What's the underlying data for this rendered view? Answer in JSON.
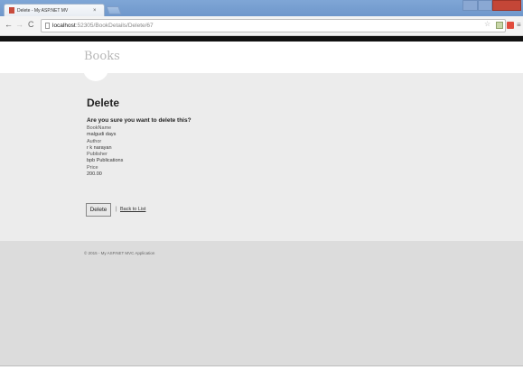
{
  "browser": {
    "tab_title": "Delete - My ASP.NET MV",
    "tab_close": "×",
    "url_host": "localhost",
    "url_path": ":52305/BookDetails/Delete/67",
    "nav_back": "←",
    "nav_forward": "→",
    "nav_reload": "C",
    "star": "☆",
    "menu": "≡"
  },
  "site": {
    "brand": "Books"
  },
  "page": {
    "heading": "Delete",
    "question": "Are you sure you want to delete this?",
    "fields": [
      {
        "label": "BookName",
        "value": "malgudi days"
      },
      {
        "label": "Author",
        "value": "r k narayan"
      },
      {
        "label": "Publisher",
        "value": "bpb Publications"
      },
      {
        "label": "Price",
        "value": "200.00"
      }
    ],
    "delete_button": "Delete",
    "separator": "|",
    "back_link": "Back to List"
  },
  "footer": {
    "text": "© 2015 - My ASP.NET MVC Application"
  },
  "colors": {
    "body_band": "#ececec",
    "footer_band": "#dcdcdc",
    "close_button": "#c44637"
  }
}
